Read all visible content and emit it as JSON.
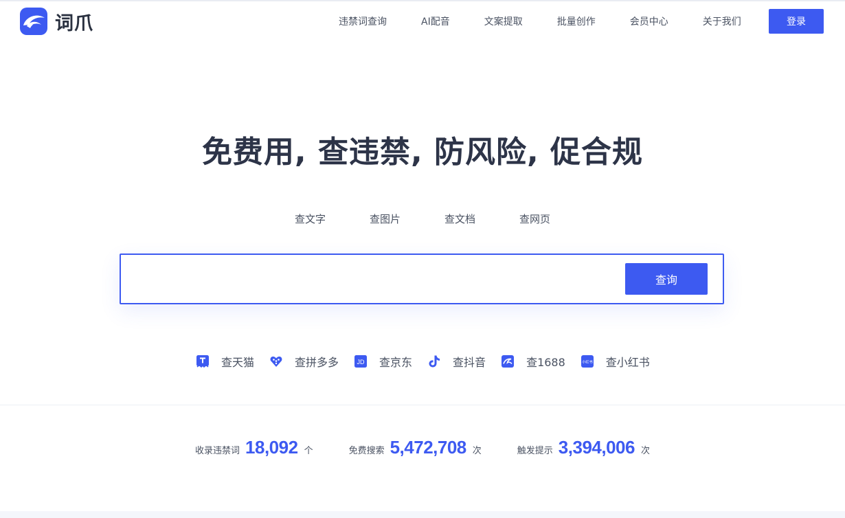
{
  "brand": {
    "name": "词爪",
    "accent": "#3d5af1"
  },
  "nav": {
    "items": [
      "违禁词查询",
      "AI配音",
      "文案提取",
      "批量创作",
      "会员中心",
      "关于我们"
    ],
    "login_label": "登录"
  },
  "hero": {
    "title": "免费用, 查违禁, 防风险, 促合规"
  },
  "tabs": [
    "查文字",
    "查图片",
    "查文档",
    "查网页"
  ],
  "search": {
    "value": "",
    "placeholder": "",
    "button_label": "查询"
  },
  "platforms": [
    {
      "icon": "tmall-icon",
      "label": "查天猫"
    },
    {
      "icon": "pinduoduo-icon",
      "label": "查拼多多"
    },
    {
      "icon": "jd-icon",
      "label": "查京东"
    },
    {
      "icon": "douyin-icon",
      "label": "查抖音"
    },
    {
      "icon": "1688-icon",
      "label": "查1688"
    },
    {
      "icon": "xiaohongshu-icon",
      "label": "查小红书"
    }
  ],
  "platform_icon_text": {
    "jd": "JD",
    "xiaohongshu": "小红书"
  },
  "stats": [
    {
      "label": "收录违禁词",
      "value": "18,092",
      "unit": "个"
    },
    {
      "label": "免费搜索",
      "value": "5,472,708",
      "unit": "次"
    },
    {
      "label": "触发提示",
      "value": "3,394,006",
      "unit": "次"
    }
  ]
}
